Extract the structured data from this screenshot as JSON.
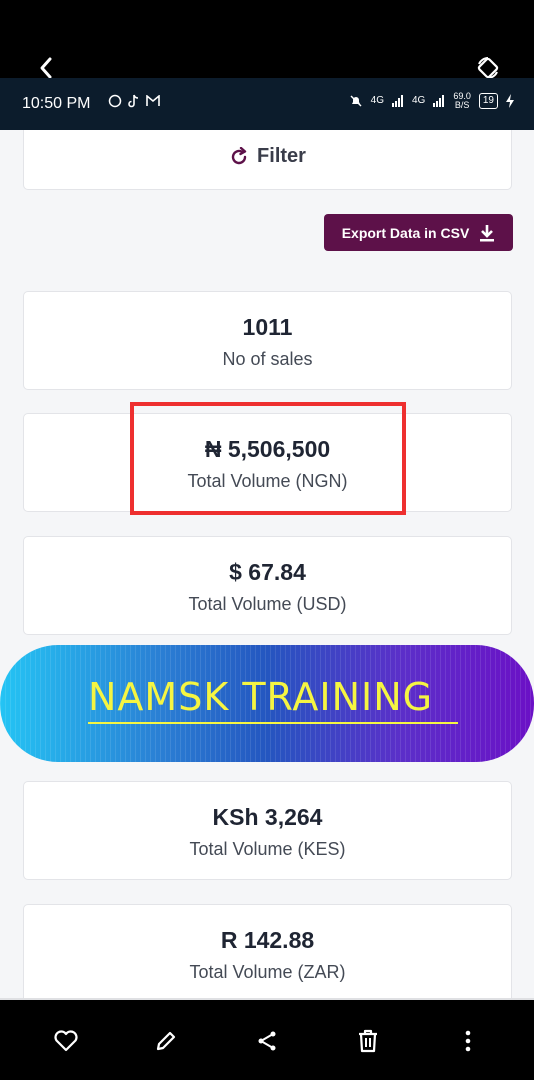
{
  "statusbar": {
    "time": "10:50 PM",
    "net1": "4G",
    "net2": "4G",
    "speed_value": "69.0",
    "speed_unit": "B/S",
    "battery": "19"
  },
  "filter": {
    "label": "Filter"
  },
  "export": {
    "label": "Export Data in CSV"
  },
  "stats": [
    {
      "value": "1011",
      "label": "No of sales"
    },
    {
      "value": "₦ 5,506,500",
      "label": "Total Volume (NGN)"
    },
    {
      "value": "$ 67.84",
      "label": "Total Volume (USD)"
    },
    {
      "value": "KSh 3,264",
      "label": "Total Volume (KES)"
    },
    {
      "value": "R 142.88",
      "label": "Total Volume (ZAR)"
    }
  ],
  "banner": {
    "text": "NAMSK TRAINING"
  },
  "colors": {
    "export_button": "#5d1149",
    "highlight": "#ee2f2f",
    "banner_text": "#f5f542"
  },
  "icons": {
    "back": "chevron-left-icon",
    "rotate": "rotate-icon",
    "heart": "heart-icon",
    "edit": "pencil-icon",
    "share": "share-icon",
    "delete": "trash-icon",
    "more": "more-vertical-icon"
  }
}
